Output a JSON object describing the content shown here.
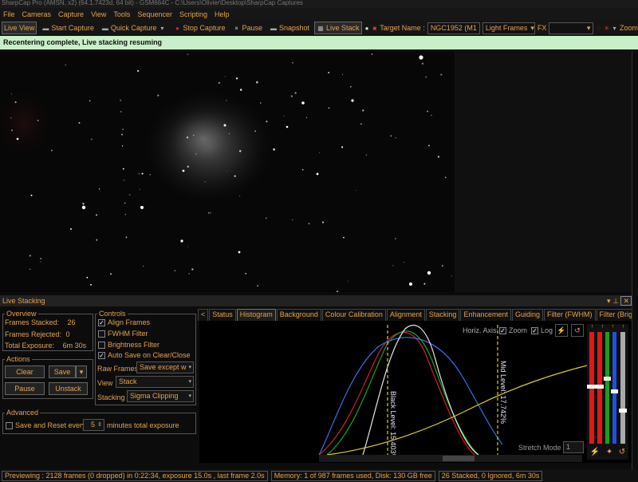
{
  "window": {
    "title": "SharpCap Pro (AMSN, x2) (64.1.7423d, 64 bit) - GSM664C - C:\\Users\\Olivier\\Desktop\\SharpCap Captures"
  },
  "menu": [
    "File",
    "Cameras",
    "Capture",
    "View",
    "Tools",
    "Sequencer",
    "Scripting",
    "Help"
  ],
  "toolbar": {
    "live_view": "Live View",
    "start_capture": "Start Capture",
    "quick_capture": "Quick Capture",
    "stop_capture": "Stop Capture",
    "pause": "Pause",
    "snapshot": "Snapshot",
    "live_stack": "Live Stack",
    "target_label": "Target Name :",
    "target_value": "NGC1952 (M1",
    "frame_type": "Light Frames",
    "fx_label": "FX",
    "fx_value": "",
    "zoom_label": "Zoom"
  },
  "status_message": "Recentering complete, Live stacking resuming",
  "live_stacking": {
    "title": "Live Stacking",
    "overview": {
      "legend": "Overview",
      "frames_stacked_label": "Frames Stacked:",
      "frames_stacked": "26",
      "frames_rejected_label": "Frames Rejected:",
      "frames_rejected": "0",
      "total_exposure_label": "Total Exposure:",
      "total_exposure": "6m 30s"
    },
    "actions": {
      "legend": "Actions",
      "clear": "Clear",
      "save": "Save",
      "pause": "Pause",
      "unstack": "Unstack"
    },
    "controls": {
      "legend": "Controls",
      "align_frames": "Align Frames",
      "align_checked": true,
      "fwhm_filter": "FWHM Filter",
      "fwhm_checked": false,
      "brightness_filter": "Brightness Filter",
      "brightness_checked": false,
      "auto_save": "Auto Save on Clear/Close",
      "auto_save_checked": true,
      "raw_frames_label": "Raw Frames",
      "raw_frames_value": "Save except w",
      "view_label": "View",
      "view_value": "Stack",
      "stacking_label": "Stacking",
      "stacking_value": "Sigma Clipping"
    },
    "advanced": {
      "legend": "Advanced",
      "save_reset_label": "Save and Reset every",
      "save_reset_value": "5",
      "minutes_label": "minutes total exposure"
    },
    "tabs": [
      "Status",
      "Histogram",
      "Background",
      "Colour Calibration",
      "Alignment",
      "Stacking",
      "Enhancement",
      "Guiding",
      "Filter (FWHM)",
      "Filter (Brightness)"
    ],
    "selected_tab": "Histogram",
    "histogram": {
      "horiz_axis_label": "Horiz. Axis:",
      "zoom_label": "Zoom",
      "log_label": "Log",
      "black_level_label": "Black Level: 15.403%",
      "mid_level_label": "Mid Level: 17.742%",
      "stretch_mode_label": "Stretch Mode",
      "stretch_mode_value": "1",
      "colors": {
        "red": "#d42020",
        "green": "#1fa01f",
        "blue": "#3a6fe0",
        "white": "#e8e8e8",
        "yellow": "#d8d020"
      }
    }
  },
  "footer": {
    "previewing": "Previewing : 2128 frames (0 dropped) in 0:22:34, exposure 15.0s , last frame 2.0s",
    "memory": "Memory: 1 of 987 frames used, Disk: 130 GB free",
    "stack_summary": "26 Stacked, 0 Ignored, 6m 30s"
  }
}
